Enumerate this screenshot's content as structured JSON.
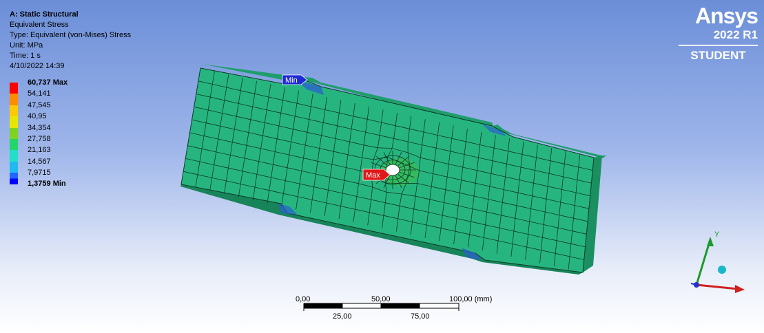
{
  "info": {
    "title": "A: Static Structural",
    "result": "Equivalent Stress",
    "type": "Type: Equivalent (von-Mises) Stress",
    "unit": "Unit: MPa",
    "time": "Time: 1 s",
    "date": "4/10/2022 14:39"
  },
  "legend": {
    "labels": [
      "60,737 Max",
      "54,141",
      "47,545",
      "40,95",
      "34,354",
      "27,758",
      "21,163",
      "14,567",
      "7,9715",
      "1,3759 Min"
    ],
    "colors": [
      "#ff0000",
      "#ff8c00",
      "#ffc800",
      "#e6e600",
      "#7ed321",
      "#22d66a",
      "#22e0c8",
      "#22b8f0",
      "#2266ff",
      "#0000ff"
    ]
  },
  "logo": {
    "brand": "Ansys",
    "version": "2022 R1",
    "edition": "STUDENT"
  },
  "probes": {
    "min_label": "Min",
    "max_label": "Max",
    "min_color": "#1e2ad6",
    "max_color": "#e01818"
  },
  "scale_bar": {
    "top_labels": [
      "0,00",
      "50,00",
      "100,00 (mm)"
    ],
    "bottom_labels": [
      "25,00",
      "75,00"
    ]
  },
  "triad": {
    "y_label": "Y"
  },
  "colors": {
    "plate": "#27b57f",
    "mesh": "#0c3a28",
    "edge": "#1c8f62"
  }
}
